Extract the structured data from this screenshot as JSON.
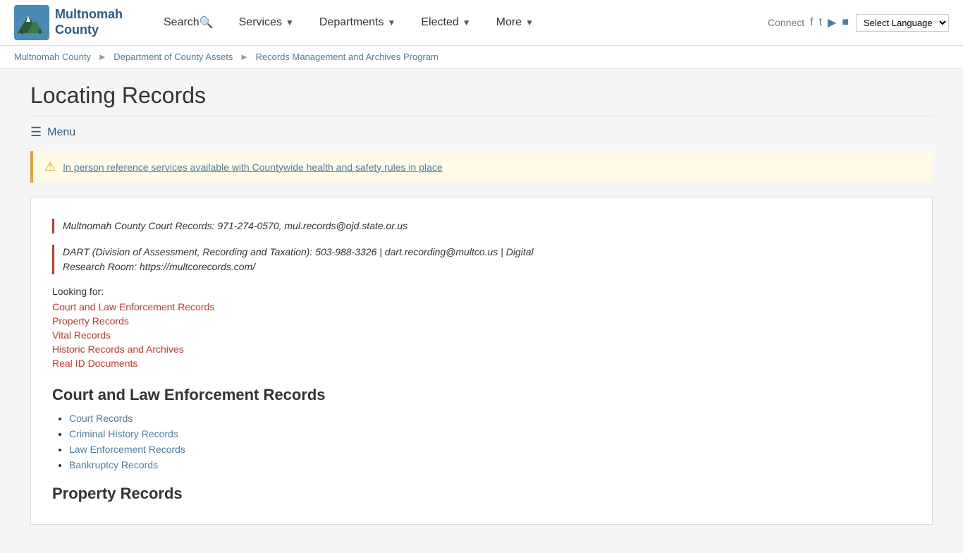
{
  "nav": {
    "logo_line1": "Multnomah",
    "logo_line2": "County",
    "items": [
      {
        "label": "Search",
        "has_chevron": false,
        "has_icon": true
      },
      {
        "label": "Services",
        "has_chevron": true
      },
      {
        "label": "Departments",
        "has_chevron": true
      },
      {
        "label": "Elected",
        "has_chevron": true
      },
      {
        "label": "More",
        "has_chevron": true
      }
    ],
    "connect_label": "Connect",
    "lang_label": "Select Language"
  },
  "breadcrumb": {
    "items": [
      {
        "label": "Multnomah County",
        "href": "#"
      },
      {
        "label": "Department of County Assets",
        "href": "#"
      },
      {
        "label": "Records Management and Archives Program",
        "href": "#"
      }
    ]
  },
  "page": {
    "title": "Locating Records",
    "menu_label": "Menu"
  },
  "alert": {
    "text": "In person reference services available with Countywide health and safety rules in place"
  },
  "info": {
    "court_records": "Multnomah County Court Records: 971-274-0570, mul.records@ojd.state.or.us",
    "dart_line1": "DART (Division of Assessment, Recording and Taxation): 503-988-3326 | dart.recording@multco.us | Digital",
    "dart_line2": "Research Room: https://multcorecords.com/"
  },
  "looking_for": {
    "label": "Looking for:",
    "links": [
      "Court and Law Enforcement Records",
      "Property Records",
      "Vital Records",
      "Historic Records and Archives",
      "Real ID Documents"
    ]
  },
  "sections": [
    {
      "id": "court-law",
      "heading": "Court and Law Enforcement Records",
      "items": [
        "Court Records",
        "Criminal History Records",
        "Law Enforcement Records",
        "Bankruptcy Records"
      ]
    }
  ],
  "property_heading": "Property Records"
}
